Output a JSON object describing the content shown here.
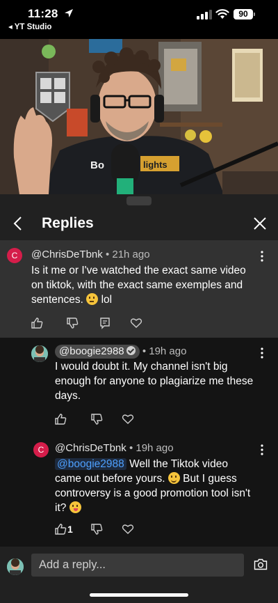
{
  "status_bar": {
    "time": "11:28",
    "back_app": "◂ YT Studio",
    "battery": "90"
  },
  "panel": {
    "title": "Replies"
  },
  "comments": [
    {
      "author": "@ChrisDeTbnk",
      "age": "• 21h ago",
      "avatar_letter": "C",
      "lines": [
        "Is it me or I've watched the exact same video",
        "on tiktok, with the exact same exemples and"
      ],
      "last_line": "sentences.",
      "last_suffix": " lol"
    },
    {
      "author": "@boogie2988",
      "age": "• 19h ago",
      "lines": [
        "I would doubt it. My channel isn't big",
        "enough for anyone to plagiarize me these",
        "days."
      ]
    },
    {
      "author": "@ChrisDeTbnk",
      "age": "• 19h ago",
      "avatar_letter": "C",
      "mention": "@boogie2988",
      "line1_rest": " Well the Tiktok video",
      "line2": "came out before yours.",
      "line2_rest": " But I guess",
      "line3": "controversy is a good promotion tool isn't",
      "line4": "it?",
      "likes": "1"
    }
  ],
  "reply_bar": {
    "placeholder": "Add a reply..."
  },
  "icons": [
    "location-arrow-icon",
    "signal-icon",
    "wifi-icon",
    "battery-icon",
    "back-chevron-icon",
    "close-icon",
    "more-vert-icon",
    "thumb-up-icon",
    "thumb-down-icon",
    "reply-icon",
    "heart-icon",
    "camera-icon"
  ],
  "colors": {
    "panel_bg": "#212121",
    "highlight_bg": "#323232",
    "reply_bg": "#141414",
    "avatar_red": "#d51d4a",
    "mention_blue": "#4ea0ff"
  }
}
